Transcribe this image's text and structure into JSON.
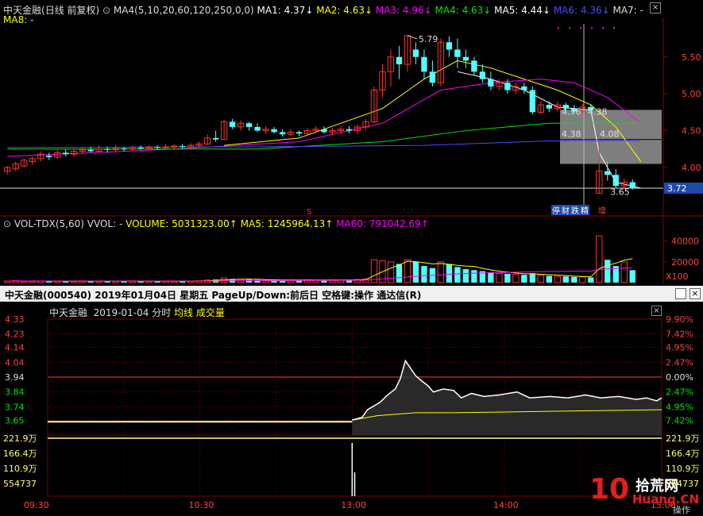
{
  "colors": {
    "up": "#ff3232",
    "down": "#54ffff",
    "ma1": "#ffffff",
    "ma2": "#ffff00",
    "ma3": "#ff00ff",
    "ma4": "#00e600",
    "ma6": "#4a4aff",
    "grid": "#7a0000",
    "price": "#ffffff",
    "avg": "#ffff00"
  },
  "top_header": {
    "stock": "中天金融",
    "mode": "(日线 前复权)",
    "ma_params": "MA4(5,10,20,60,120,250,0,0)",
    "ma1": "MA1: 4.37↓",
    "ma2": "MA2: 4.63↓",
    "ma3": "MA3: 4.96↓",
    "ma4": "MA4: 4.63↓",
    "ma5": "MA5: 4.44↓",
    "ma6": "MA6: 4.36↓",
    "ma7": "MA7: -",
    "ma8": "MA8: -"
  },
  "vol_header": {
    "name": "VOL-TDX(5,60)",
    "vvol": "VVOL: -",
    "volume": "VOLUME: 5031323.00↑",
    "ma5": "MA5: 1245964.13↑",
    "ma60": "MA60: 791042.69↑"
  },
  "minute_header": {
    "title": "中天金融(000540)  2019年01月04日 星期五 PageUp/Down:前后日 空格键:操作 通达信(R)",
    "sub_name": "中天金融",
    "sub_date": "2019-01-04 分时",
    "avg_label": "均线",
    "vol_label": "成交量"
  },
  "annotations": {
    "high": "5.79",
    "low": "3.65",
    "mark1": "4.76",
    "mark2": "4.38",
    "mark3": "4.38",
    "mark4": "4.08",
    "current": "3.72",
    "tag1": "停",
    "tag2": "财",
    "tag3": "跌",
    "tag4": "精",
    "tag5": "增",
    "s_marker": "S",
    "x100": "X100",
    "watermark_brand": "拾荒网",
    "watermark_url": "Huang.CN",
    "watermark_num": "10",
    "bottom_right": "操作"
  },
  "chart_data": [
    {
      "type": "candlestick",
      "title": "中天金融 (日线 前复权)",
      "y_ticks": [
        "5.50",
        "5.00",
        "4.50",
        "4.00"
      ],
      "ylim": [
        3.45,
        5.95
      ],
      "candles": [
        [
          3.95,
          4.0,
          3.9,
          4.02
        ],
        [
          3.98,
          4.05,
          3.95,
          4.08
        ],
        [
          4.02,
          4.1,
          4.0,
          4.12
        ],
        [
          4.08,
          4.12,
          4.04,
          4.15
        ],
        [
          4.12,
          4.18,
          4.08,
          4.22
        ],
        [
          4.16,
          4.14,
          4.1,
          4.2
        ],
        [
          4.14,
          4.2,
          4.12,
          4.24
        ],
        [
          4.2,
          4.18,
          4.15,
          4.25
        ],
        [
          4.18,
          4.22,
          4.15,
          4.26
        ],
        [
          4.22,
          4.24,
          4.18,
          4.28
        ],
        [
          4.24,
          4.22,
          4.2,
          4.28
        ],
        [
          4.22,
          4.25,
          4.2,
          4.3
        ],
        [
          4.25,
          4.24,
          4.2,
          4.28
        ],
        [
          4.24,
          4.26,
          4.22,
          4.3
        ],
        [
          4.26,
          4.25,
          4.22,
          4.28
        ],
        [
          4.25,
          4.27,
          4.22,
          4.3
        ],
        [
          4.27,
          4.26,
          4.24,
          4.3
        ],
        [
          4.26,
          4.28,
          4.24,
          4.3
        ],
        [
          4.28,
          4.27,
          4.24,
          4.3
        ],
        [
          4.27,
          4.28,
          4.25,
          4.32
        ],
        [
          4.28,
          4.29,
          4.25,
          4.32
        ],
        [
          4.29,
          4.28,
          4.26,
          4.32
        ],
        [
          4.28,
          4.3,
          4.26,
          4.33
        ],
        [
          4.3,
          4.32,
          4.28,
          4.35
        ],
        [
          4.32,
          4.4,
          4.3,
          4.45
        ],
        [
          4.4,
          4.38,
          4.35,
          4.5
        ],
        [
          4.38,
          4.62,
          4.38,
          4.65
        ],
        [
          4.62,
          4.55,
          4.52,
          4.66
        ],
        [
          4.55,
          4.6,
          4.5,
          4.64
        ],
        [
          4.6,
          4.55,
          4.5,
          4.62
        ],
        [
          4.55,
          4.5,
          4.48,
          4.6
        ],
        [
          4.5,
          4.52,
          4.46,
          4.56
        ],
        [
          4.52,
          4.48,
          4.46,
          4.55
        ],
        [
          4.48,
          4.45,
          4.42,
          4.52
        ],
        [
          4.45,
          4.48,
          4.42,
          4.52
        ],
        [
          4.48,
          4.46,
          4.42,
          4.5
        ],
        [
          4.46,
          4.5,
          4.44,
          4.54
        ],
        [
          4.5,
          4.52,
          4.46,
          4.56
        ],
        [
          4.52,
          4.48,
          4.46,
          4.56
        ],
        [
          4.48,
          4.5,
          4.44,
          4.54
        ],
        [
          4.5,
          4.52,
          4.46,
          4.56
        ],
        [
          4.52,
          4.5,
          4.46,
          4.56
        ],
        [
          4.5,
          4.55,
          4.45,
          4.58
        ],
        [
          4.55,
          4.62,
          4.5,
          4.66
        ],
        [
          4.62,
          5.05,
          4.6,
          5.1
        ],
        [
          5.05,
          5.3,
          4.95,
          5.4
        ],
        [
          5.3,
          5.5,
          5.1,
          5.6
        ],
        [
          5.5,
          5.4,
          5.2,
          5.65
        ],
        [
          5.4,
          5.79,
          5.3,
          5.79
        ],
        [
          5.6,
          5.5,
          5.4,
          5.7
        ],
        [
          5.5,
          5.3,
          5.2,
          5.6
        ],
        [
          5.3,
          5.15,
          5.1,
          5.45
        ],
        [
          5.15,
          5.7,
          5.1,
          5.75
        ],
        [
          5.7,
          5.6,
          5.5,
          5.78
        ],
        [
          5.6,
          5.5,
          5.35,
          5.75
        ],
        [
          5.5,
          5.45,
          5.35,
          5.6
        ],
        [
          5.45,
          5.3,
          5.25,
          5.5
        ],
        [
          5.3,
          5.2,
          5.15,
          5.4
        ],
        [
          5.2,
          5.1,
          5.05,
          5.3
        ],
        [
          5.1,
          5.15,
          5.05,
          5.2
        ],
        [
          5.15,
          5.05,
          5.0,
          5.2
        ],
        [
          5.05,
          5.1,
          5.0,
          5.15
        ],
        [
          5.1,
          5.05,
          5.0,
          5.15
        ],
        [
          5.05,
          4.75,
          4.72,
          5.1
        ],
        [
          4.75,
          4.85,
          4.72,
          4.9
        ],
        [
          4.85,
          4.8,
          4.75,
          4.9
        ],
        [
          4.8,
          4.85,
          4.76,
          4.9
        ],
        [
          4.85,
          4.8,
          4.76,
          4.88
        ],
        [
          4.8,
          4.76,
          4.72,
          4.85
        ],
        [
          4.76,
          4.82,
          4.72,
          4.86
        ],
        [
          4.82,
          4.78,
          4.74,
          4.86
        ],
        [
          3.65,
          3.95,
          3.65,
          4.38
        ],
        [
          3.95,
          3.9,
          3.82,
          4.08
        ],
        [
          3.9,
          3.75,
          3.72,
          3.98
        ],
        [
          3.75,
          3.8,
          3.72,
          3.85
        ],
        [
          3.8,
          3.72,
          3.7,
          3.84
        ]
      ],
      "ma_lines": {
        "ma1": [
          [
            54,
            5.3
          ],
          [
            58,
            5.2
          ],
          [
            62,
            5.05
          ],
          [
            66,
            4.82
          ],
          [
            70,
            4.78
          ],
          [
            71,
            4.2
          ],
          [
            73,
            3.8
          ],
          [
            76,
            3.72
          ]
        ],
        "ma2": [
          [
            26,
            4.3
          ],
          [
            35,
            4.4
          ],
          [
            45,
            4.8
          ],
          [
            50,
            5.2
          ],
          [
            54,
            5.45
          ],
          [
            58,
            5.35
          ],
          [
            62,
            5.2
          ],
          [
            66,
            5.05
          ],
          [
            70,
            4.85
          ],
          [
            73,
            4.55
          ],
          [
            76,
            4.08
          ]
        ],
        "ma3": [
          [
            0,
            4.15
          ],
          [
            20,
            4.25
          ],
          [
            35,
            4.35
          ],
          [
            45,
            4.6
          ],
          [
            52,
            5.05
          ],
          [
            58,
            5.15
          ],
          [
            64,
            5.2
          ],
          [
            68,
            5.15
          ],
          [
            72,
            4.95
          ],
          [
            76,
            4.6
          ]
        ],
        "ma4": [
          [
            0,
            4.25
          ],
          [
            30,
            4.25
          ],
          [
            45,
            4.35
          ],
          [
            55,
            4.5
          ],
          [
            65,
            4.6
          ],
          [
            76,
            4.6
          ]
        ],
        "ma6": [
          [
            0,
            4.27
          ],
          [
            30,
            4.28
          ],
          [
            50,
            4.3
          ],
          [
            65,
            4.36
          ],
          [
            76,
            4.36
          ]
        ]
      }
    },
    {
      "type": "bar",
      "title": "VOL-TDX(5,60)",
      "y_ticks": [
        "40000",
        "20000"
      ],
      "unit": "X100",
      "ylim": [
        0,
        52000
      ],
      "values": [
        1500,
        1800,
        1200,
        1400,
        1600,
        1300,
        1500,
        1400,
        1300,
        1600,
        1500,
        1400,
        1300,
        1500,
        1400,
        1600,
        1500,
        1400,
        1300,
        1500,
        1400,
        1600,
        1500,
        1700,
        2500,
        3000,
        4500,
        3500,
        3000,
        2800,
        2500,
        2600,
        2400,
        2300,
        2500,
        2400,
        2600,
        2500,
        2400,
        2600,
        2500,
        2700,
        3000,
        3500,
        22000,
        21000,
        20000,
        18000,
        22000,
        20000,
        16000,
        14000,
        20000,
        18000,
        15000,
        13000,
        12000,
        11000,
        10000,
        9000,
        8500,
        8000,
        7500,
        9000,
        7000,
        6500,
        6000,
        6000,
        5500,
        5500,
        5000,
        45000,
        22000,
        16000,
        20000,
        12000
      ]
    },
    {
      "type": "line",
      "title": "中天金融 2019-01-04 分时",
      "x_ticks": [
        "09:30",
        "10:30",
        "13:00",
        "14:00",
        "15:00"
      ],
      "y_ticks_left": [
        "4.33",
        "4.23",
        "4.14",
        "4.04",
        "3.94",
        "3.84",
        "3.74",
        "3.65"
      ],
      "y_ticks_right": [
        "9.90%",
        "7.42%",
        "4.95%",
        "2.47%",
        "0.00%",
        "2.47%",
        "4.95%",
        "7.42%"
      ],
      "ylim": [
        3.55,
        4.33
      ],
      "prev_close": 3.94,
      "price": [
        [
          120,
          3.65
        ],
        [
          124,
          3.67
        ],
        [
          126,
          3.72
        ],
        [
          128,
          3.74
        ],
        [
          131,
          3.77
        ],
        [
          134,
          3.82
        ],
        [
          137,
          3.86
        ],
        [
          139,
          3.93
        ],
        [
          141,
          4.05
        ],
        [
          143,
          4.0
        ],
        [
          145,
          3.95
        ],
        [
          147,
          3.92
        ],
        [
          150,
          3.88
        ],
        [
          152,
          3.84
        ],
        [
          156,
          3.86
        ],
        [
          160,
          3.85
        ],
        [
          163,
          3.8
        ],
        [
          167,
          3.83
        ],
        [
          172,
          3.81
        ],
        [
          178,
          3.82
        ],
        [
          185,
          3.84
        ],
        [
          190,
          3.8
        ],
        [
          198,
          3.81
        ],
        [
          205,
          3.8
        ],
        [
          212,
          3.82
        ],
        [
          218,
          3.8
        ],
        [
          225,
          3.81
        ],
        [
          232,
          3.79
        ],
        [
          236,
          3.8
        ],
        [
          240,
          3.78
        ],
        [
          242,
          3.8
        ]
      ],
      "avg": [
        [
          120,
          3.65
        ],
        [
          130,
          3.68
        ],
        [
          145,
          3.7
        ],
        [
          160,
          3.7
        ],
        [
          200,
          3.71
        ],
        [
          242,
          3.72
        ]
      ],
      "volume_ticks": [
        "221.9万",
        "166.4万",
        "110.9万",
        "554737"
      ],
      "volume_spike": [
        [
          120,
          221.9
        ],
        [
          121,
          80
        ]
      ]
    }
  ]
}
